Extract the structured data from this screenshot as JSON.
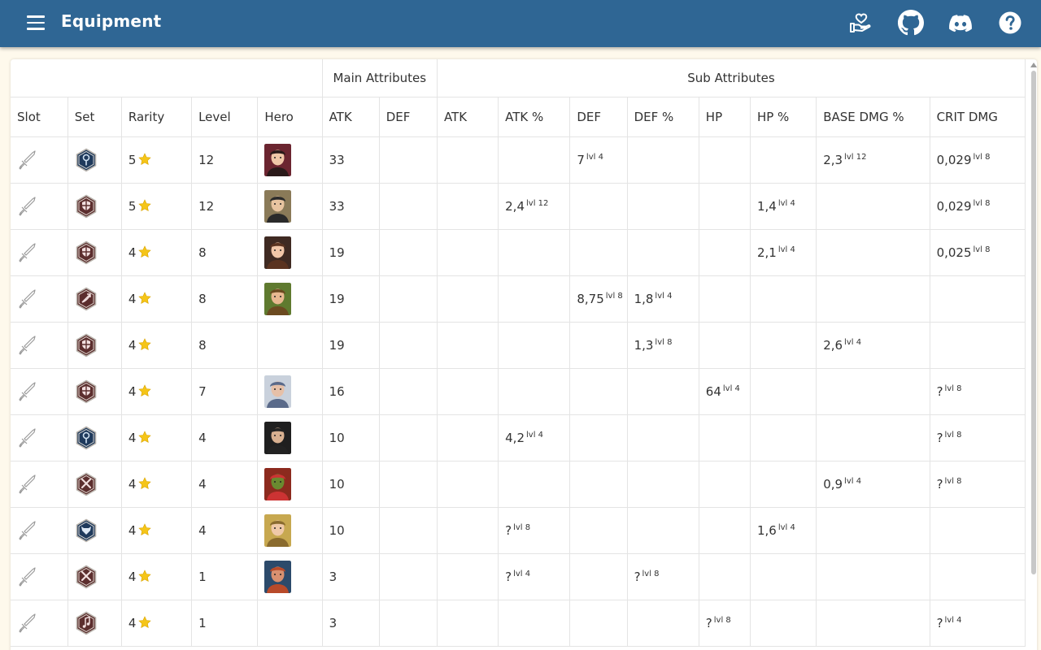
{
  "app": {
    "title": "Equipment",
    "header_color": "#2f6694",
    "icons": [
      "donate-hand-heart-icon",
      "github-icon",
      "discord-icon",
      "help-question-icon"
    ]
  },
  "table": {
    "group_headers": {
      "main": "Main Attributes",
      "sub": "Sub Attributes"
    },
    "columns": [
      "Slot",
      "Set",
      "Rarity",
      "Level",
      "Hero",
      "ATK",
      "DEF",
      "ATK",
      "ATK %",
      "DEF",
      "DEF %",
      "HP",
      "HP %",
      "BASE DMG %",
      "CRIT DMG"
    ],
    "rows": [
      {
        "slot": "sword-icon",
        "set": "chain-set-icon",
        "set_color": "#1f3a5c",
        "rarity": "5",
        "level": "12",
        "hero": "hero-1",
        "main_atk": "33",
        "main_def": "",
        "sub_atk": "",
        "sub_atk_pct": "",
        "sub_atk_pct_lvl": "",
        "sub_def": "7",
        "sub_def_lvl": "lvl 4",
        "sub_def_pct": "",
        "sub_def_pct_lvl": "",
        "sub_hp": "",
        "sub_hp_lvl": "",
        "sub_hp_pct": "",
        "sub_hp_pct_lvl": "",
        "sub_base_dmg": "2,3",
        "sub_base_dmg_lvl": "lvl 12",
        "sub_crit": "0,029",
        "sub_crit_lvl": "lvl 8"
      },
      {
        "slot": "sword-icon",
        "set": "shield-set-icon",
        "set_color": "#5c2e2e",
        "rarity": "5",
        "level": "12",
        "hero": "hero-2",
        "main_atk": "33",
        "main_def": "",
        "sub_atk": "",
        "sub_atk_pct": "2,4",
        "sub_atk_pct_lvl": "lvl 12",
        "sub_def": "",
        "sub_def_lvl": "",
        "sub_def_pct": "",
        "sub_def_pct_lvl": "",
        "sub_hp": "",
        "sub_hp_lvl": "",
        "sub_hp_pct": "1,4",
        "sub_hp_pct_lvl": "lvl 4",
        "sub_base_dmg": "",
        "sub_base_dmg_lvl": "",
        "sub_crit": "0,029",
        "sub_crit_lvl": "lvl 8"
      },
      {
        "slot": "sword-icon",
        "set": "shield-set-icon",
        "set_color": "#5c2e2e",
        "rarity": "4",
        "level": "8",
        "hero": "hero-3",
        "main_atk": "19",
        "main_def": "",
        "sub_atk": "",
        "sub_atk_pct": "",
        "sub_atk_pct_lvl": "",
        "sub_def": "",
        "sub_def_lvl": "",
        "sub_def_pct": "",
        "sub_def_pct_lvl": "",
        "sub_hp": "",
        "sub_hp_lvl": "",
        "sub_hp_pct": "2,1",
        "sub_hp_pct_lvl": "lvl 4",
        "sub_base_dmg": "",
        "sub_base_dmg_lvl": "",
        "sub_crit": "0,025",
        "sub_crit_lvl": "lvl 8"
      },
      {
        "slot": "sword-icon",
        "set": "bow-set-icon",
        "set_color": "#5c2e2e",
        "rarity": "4",
        "level": "8",
        "hero": "hero-4",
        "main_atk": "19",
        "main_def": "",
        "sub_atk": "",
        "sub_atk_pct": "",
        "sub_atk_pct_lvl": "",
        "sub_def": "8,75",
        "sub_def_lvl": "lvl 8",
        "sub_def_pct": "1,8",
        "sub_def_pct_lvl": "lvl 4",
        "sub_hp": "",
        "sub_hp_lvl": "",
        "sub_hp_pct": "",
        "sub_hp_pct_lvl": "",
        "sub_base_dmg": "",
        "sub_base_dmg_lvl": "",
        "sub_crit": "",
        "sub_crit_lvl": ""
      },
      {
        "slot": "sword-icon",
        "set": "shield-set-icon",
        "set_color": "#5c2e2e",
        "rarity": "4",
        "level": "8",
        "hero": "",
        "main_atk": "19",
        "main_def": "",
        "sub_atk": "",
        "sub_atk_pct": "",
        "sub_atk_pct_lvl": "",
        "sub_def": "",
        "sub_def_lvl": "",
        "sub_def_pct": "1,3",
        "sub_def_pct_lvl": "lvl 8",
        "sub_hp": "",
        "sub_hp_lvl": "",
        "sub_hp_pct": "",
        "sub_hp_pct_lvl": "",
        "sub_base_dmg": "2,6",
        "sub_base_dmg_lvl": "lvl 4",
        "sub_crit": "",
        "sub_crit_lvl": ""
      },
      {
        "slot": "sword-icon",
        "set": "shield-set-icon",
        "set_color": "#5c2e2e",
        "rarity": "4",
        "level": "7",
        "hero": "hero-6",
        "main_atk": "16",
        "main_def": "",
        "sub_atk": "",
        "sub_atk_pct": "",
        "sub_atk_pct_lvl": "",
        "sub_def": "",
        "sub_def_lvl": "",
        "sub_def_pct": "",
        "sub_def_pct_lvl": "",
        "sub_hp": "64",
        "sub_hp_lvl": "lvl 4",
        "sub_hp_pct": "",
        "sub_hp_pct_lvl": "",
        "sub_base_dmg": "",
        "sub_base_dmg_lvl": "",
        "sub_crit": "?",
        "sub_crit_lvl": "lvl 8"
      },
      {
        "slot": "sword-icon",
        "set": "chain-set-icon",
        "set_color": "#1f3a5c",
        "rarity": "4",
        "level": "4",
        "hero": "hero-7",
        "main_atk": "10",
        "main_def": "",
        "sub_atk": "",
        "sub_atk_pct": "4,2",
        "sub_atk_pct_lvl": "lvl 4",
        "sub_def": "",
        "sub_def_lvl": "",
        "sub_def_pct": "",
        "sub_def_pct_lvl": "",
        "sub_hp": "",
        "sub_hp_lvl": "",
        "sub_hp_pct": "",
        "sub_hp_pct_lvl": "",
        "sub_base_dmg": "",
        "sub_base_dmg_lvl": "",
        "sub_crit": "?",
        "sub_crit_lvl": "lvl 8"
      },
      {
        "slot": "sword-icon",
        "set": "crossed-swords-set-icon",
        "set_color": "#5c2e2e",
        "rarity": "4",
        "level": "4",
        "hero": "hero-8",
        "main_atk": "10",
        "main_def": "",
        "sub_atk": "",
        "sub_atk_pct": "",
        "sub_atk_pct_lvl": "",
        "sub_def": "",
        "sub_def_lvl": "",
        "sub_def_pct": "",
        "sub_def_pct_lvl": "",
        "sub_hp": "",
        "sub_hp_lvl": "",
        "sub_hp_pct": "",
        "sub_hp_pct_lvl": "",
        "sub_base_dmg": "0,9",
        "sub_base_dmg_lvl": "lvl 4",
        "sub_crit": "?",
        "sub_crit_lvl": "lvl 8"
      },
      {
        "slot": "sword-icon",
        "set": "wolf-set-icon",
        "set_color": "#1f3a5c",
        "rarity": "4",
        "level": "4",
        "hero": "hero-9",
        "main_atk": "10",
        "main_def": "",
        "sub_atk": "",
        "sub_atk_pct": "?",
        "sub_atk_pct_lvl": "lvl 8",
        "sub_def": "",
        "sub_def_lvl": "",
        "sub_def_pct": "",
        "sub_def_pct_lvl": "",
        "sub_hp": "",
        "sub_hp_lvl": "",
        "sub_hp_pct": "1,6",
        "sub_hp_pct_lvl": "lvl 4",
        "sub_base_dmg": "",
        "sub_base_dmg_lvl": "",
        "sub_crit": "",
        "sub_crit_lvl": ""
      },
      {
        "slot": "sword-icon",
        "set": "crossed-swords-set-icon",
        "set_color": "#5c2e2e",
        "rarity": "4",
        "level": "1",
        "hero": "hero-10",
        "main_atk": "3",
        "main_def": "",
        "sub_atk": "",
        "sub_atk_pct": "?",
        "sub_atk_pct_lvl": "lvl 4",
        "sub_def": "",
        "sub_def_lvl": "",
        "sub_def_pct": "?",
        "sub_def_pct_lvl": "lvl 8",
        "sub_hp": "",
        "sub_hp_lvl": "",
        "sub_hp_pct": "",
        "sub_hp_pct_lvl": "",
        "sub_base_dmg": "",
        "sub_base_dmg_lvl": "",
        "sub_crit": "",
        "sub_crit_lvl": ""
      },
      {
        "slot": "sword-icon",
        "set": "music-note-set-icon",
        "set_color": "#5c2e2e",
        "rarity": "4",
        "level": "1",
        "hero": "",
        "main_atk": "3",
        "main_def": "",
        "sub_atk": "",
        "sub_atk_pct": "",
        "sub_atk_pct_lvl": "",
        "sub_def": "",
        "sub_def_lvl": "",
        "sub_def_pct": "",
        "sub_def_pct_lvl": "",
        "sub_hp": "?",
        "sub_hp_lvl": "lvl 8",
        "sub_hp_pct": "",
        "sub_hp_pct_lvl": "",
        "sub_base_dmg": "",
        "sub_base_dmg_lvl": "",
        "sub_crit": "?",
        "sub_crit_lvl": "lvl 4"
      }
    ]
  }
}
